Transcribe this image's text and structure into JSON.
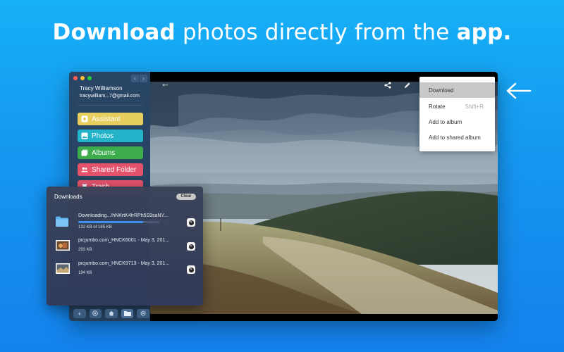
{
  "headline": {
    "bold1": "Download",
    "regular": " photos directly from the ",
    "bold2": "app."
  },
  "window": {
    "traffic_colors": [
      "#ff5f57",
      "#febc2e",
      "#28c840"
    ],
    "nav_back": "‹",
    "nav_forward": "›"
  },
  "sidebar": {
    "user_name": "Tracy Williamson",
    "user_email": "tracywilliam...7@gmail.com",
    "items": [
      {
        "label": "Assistant",
        "icon": "assistant-icon",
        "color": "#e6cf5e"
      },
      {
        "label": "Photos",
        "icon": "photos-icon",
        "color": "#25b3c9"
      },
      {
        "label": "Albums",
        "icon": "albums-icon",
        "color": "#3bab4b"
      },
      {
        "label": "Shared Folder",
        "icon": "shared-folder-icon",
        "color": "#e4536c"
      },
      {
        "label": "Trash",
        "icon": "trash-icon",
        "color": "#e4536c"
      }
    ]
  },
  "viewer": {
    "back_icon": "←",
    "share_icon": "share-icon",
    "edit_icon": "edit-icon"
  },
  "context_menu": {
    "items": [
      {
        "label": "Download",
        "shortcut": "",
        "active": true
      },
      {
        "label": "Rotate",
        "shortcut": "Shift+R",
        "active": false
      },
      {
        "label": "Add to album",
        "shortcut": "",
        "active": false
      },
      {
        "label": "Add to shared album",
        "shortcut": "",
        "active": false
      }
    ]
  },
  "downloads": {
    "title": "Downloads",
    "clear_label": "Clear",
    "items": [
      {
        "name": "Downloading.../hNKrtK4frRPh5S9saNY...",
        "size": "132 KB of 165 KB",
        "progress": 0.8,
        "thumb": "folder-icon"
      },
      {
        "name": "picjumbo.com_HNCK6001 - May 3, 201...",
        "size": "293 KB",
        "thumb": "photo-thumb-1"
      },
      {
        "name": "picjumbo.com_HNCK9713 - May 3, 201...",
        "size": "194 KB",
        "thumb": "photo-thumb-2"
      }
    ]
  },
  "toolbar": {
    "buttons": [
      "add-icon",
      "assistant-icon",
      "home-icon",
      "folder-icon",
      "settings-icon"
    ],
    "active": "folder-icon"
  }
}
